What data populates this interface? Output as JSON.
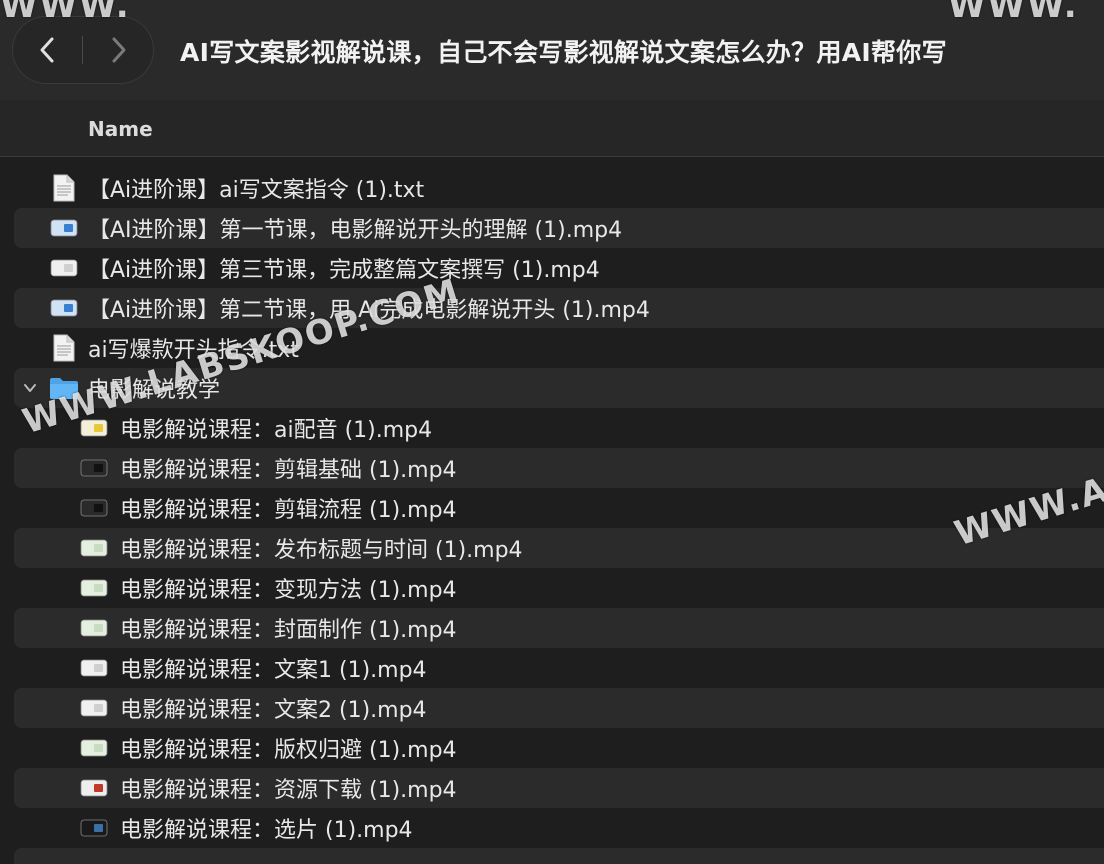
{
  "window": {
    "title": "AI写文案影视解说课，自己不会写影视解说文案怎么办？用AI帮你写"
  },
  "nav": {
    "back_icon": "chevron-left-icon",
    "forward_icon": "chevron-right-icon"
  },
  "header": {
    "name_column": "Name"
  },
  "files": [
    {
      "name": "【Ai进阶课】ai写文案指令 (1).txt",
      "kind": "txt",
      "indent": 0,
      "alt": false
    },
    {
      "name": "【AI进阶课】第一节课，电影解说开头的理解 (1).mp4",
      "kind": "video-blue",
      "indent": 0,
      "alt": true
    },
    {
      "name": "【Ai进阶课】第三节课，完成整篇文案撰写 (1).mp4",
      "kind": "video-white",
      "indent": 0,
      "alt": false
    },
    {
      "name": "【Ai进阶课】第二节课，用 Ai完成电影解说开头 (1).mp4",
      "kind": "video-blue",
      "indent": 0,
      "alt": true
    },
    {
      "name": "ai写爆款开头指令.txt",
      "kind": "txt",
      "indent": 0,
      "alt": false
    },
    {
      "name": "电影解说教学",
      "kind": "folder",
      "indent": 0,
      "alt": true,
      "expanded": true
    },
    {
      "name": "电影解说课程：ai配音 (1).mp4",
      "kind": "video-yellow",
      "indent": 1,
      "alt": false
    },
    {
      "name": "电影解说课程：剪辑基础 (1).mp4",
      "kind": "video-dark",
      "indent": 1,
      "alt": true
    },
    {
      "name": "电影解说课程：剪辑流程 (1).mp4",
      "kind": "video-dark",
      "indent": 1,
      "alt": false
    },
    {
      "name": "电影解说课程：发布标题与时间 (1).mp4",
      "kind": "video-green",
      "indent": 1,
      "alt": true
    },
    {
      "name": "电影解说课程：变现方法 (1).mp4",
      "kind": "video-green",
      "indent": 1,
      "alt": false
    },
    {
      "name": "电影解说课程：封面制作 (1).mp4",
      "kind": "video-green",
      "indent": 1,
      "alt": true
    },
    {
      "name": "电影解说课程：文案1 (1).mp4",
      "kind": "video-white",
      "indent": 1,
      "alt": false
    },
    {
      "name": "电影解说课程：文案2 (1).mp4",
      "kind": "video-white",
      "indent": 1,
      "alt": true
    },
    {
      "name": "电影解说课程：版权归避 (1).mp4",
      "kind": "video-green",
      "indent": 1,
      "alt": false
    },
    {
      "name": "电影解说课程：资源下载 (1).mp4",
      "kind": "video-red",
      "indent": 1,
      "alt": true
    },
    {
      "name": "电影解说课程：选片 (1).mp4",
      "kind": "video-black",
      "indent": 1,
      "alt": false
    }
  ],
  "watermarks": [
    "WWW.",
    "WWW.",
    "WWW.LABSKOOP.COM",
    "WWW.A"
  ],
  "colors": {
    "window_bg": "#1e1e1e",
    "titlebar_bg": "#2a2a2a",
    "row_alt_bg": "#2b2b2b",
    "folder_blue": "#5aaef0",
    "text": "#e8e8e8"
  }
}
